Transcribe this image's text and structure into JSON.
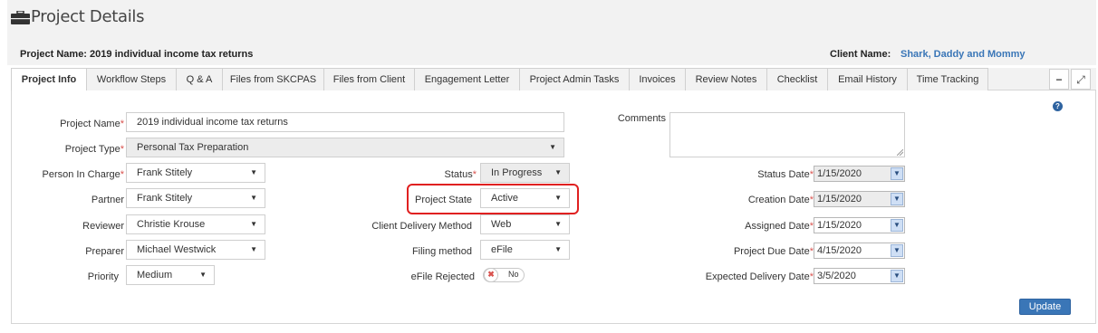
{
  "page": {
    "title": "Project Details"
  },
  "project_bar": {
    "project_name_label": "Project Name:",
    "project_name_value": "2019 individual income tax returns",
    "client_name_label": "Client Name:",
    "client_name_value": "Shark, Daddy and Mommy"
  },
  "tabs": [
    "Project Info",
    "Workflow Steps",
    "Q & A",
    "Files from SKCPAS",
    "Files from Client",
    "Engagement Letter",
    "Project Admin Tasks",
    "Invoices",
    "Review Notes",
    "Checklist",
    "Email History",
    "Time Tracking"
  ],
  "tab_controls": {
    "minimize": "−",
    "expand": "⤢"
  },
  "form": {
    "project_name": {
      "label": "Project Name",
      "value": "2019 individual income tax returns"
    },
    "project_type": {
      "label": "Project Type",
      "value": "Personal Tax Preparation"
    },
    "comments": {
      "label": "Comments",
      "value": ""
    },
    "person_in_charge": {
      "label": "Person In Charge",
      "value": "Frank Stitely"
    },
    "partner": {
      "label": "Partner",
      "value": "Frank Stitely"
    },
    "reviewer": {
      "label": "Reviewer",
      "value": "Christie Krouse"
    },
    "preparer": {
      "label": "Preparer",
      "value": "Michael Westwick"
    },
    "priority": {
      "label": "Priority",
      "value": "Medium"
    },
    "status": {
      "label": "Status",
      "value": "In Progress"
    },
    "project_state": {
      "label": "Project State",
      "value": "Active"
    },
    "client_delivery_method": {
      "label": "Client Delivery Method",
      "value": "Web"
    },
    "filing_method": {
      "label": "Filing method",
      "value": "eFile"
    },
    "efile_rejected": {
      "label": "eFile Rejected",
      "toggle_text": "No",
      "toggle_icon": "✖"
    },
    "status_date": {
      "label": "Status Date",
      "value": "1/15/2020"
    },
    "creation_date": {
      "label": "Creation Date",
      "value": "1/15/2020"
    },
    "assigned_date": {
      "label": "Assigned Date",
      "value": "1/15/2020"
    },
    "project_due_date": {
      "label": "Project Due Date",
      "value": "4/15/2020"
    },
    "expected_delivery_date": {
      "label": "Expected Delivery Date",
      "value": "3/5/2020"
    }
  },
  "required_mark": "*",
  "help_icon": "?",
  "update_label": "Update",
  "colors": {
    "accent": "#3a76b7",
    "required": "#d9534f",
    "highlight": "#e02020"
  }
}
